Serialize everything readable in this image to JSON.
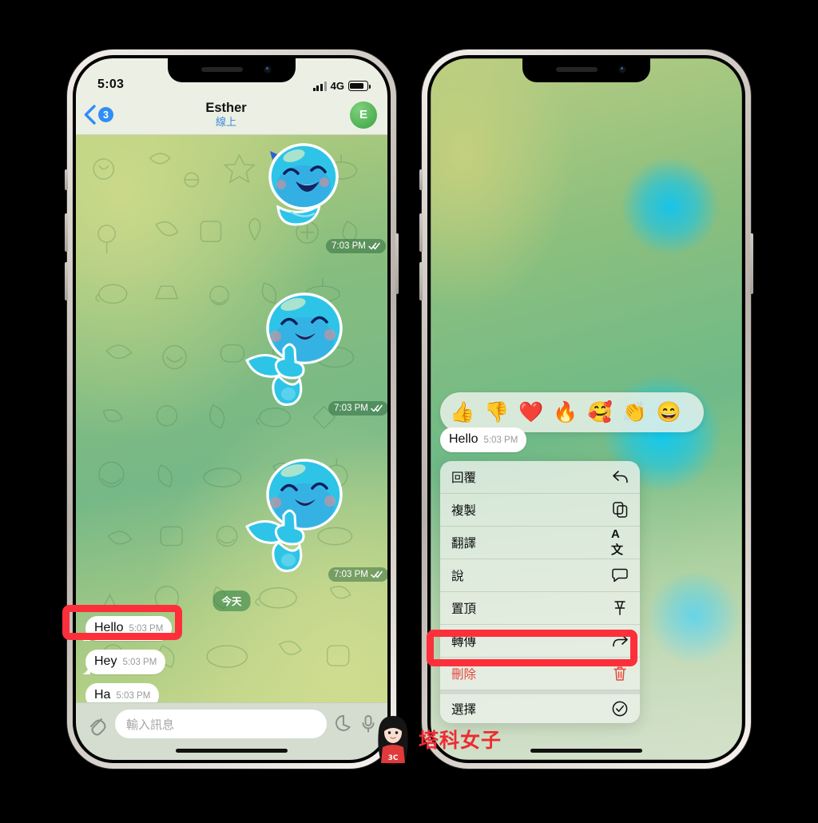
{
  "left_phone": {
    "status_bar": {
      "time": "5:03",
      "network": "4G",
      "battery_level": 72
    },
    "header": {
      "back_badge": "3",
      "contact_name": "Esther",
      "contact_status": "線上",
      "avatar_initial": "E"
    },
    "messages": [
      {
        "type": "sticker",
        "sticker": "blue-blob-laughing",
        "time": "7:03 PM",
        "status": "read"
      },
      {
        "type": "sticker",
        "sticker": "blue-blob-thumbs-up",
        "time": "7:03 PM",
        "status": "read"
      },
      {
        "type": "sticker",
        "sticker": "blue-blob-thumbs-up",
        "time": "7:03 PM",
        "status": "read"
      }
    ],
    "day_divider": "今天",
    "incoming": [
      {
        "text": "Hello",
        "time": "5:03 PM"
      },
      {
        "text": "Hey",
        "time": "5:03 PM"
      },
      {
        "text": "Ha",
        "time": "5:03 PM"
      }
    ],
    "input_bar": {
      "placeholder": "輸入訊息",
      "attach_icon": "paperclip-icon",
      "sticker_icon": "sticker-icon",
      "mic_icon": "microphone-icon"
    }
  },
  "right_phone": {
    "reactions": [
      "👍",
      "👎",
      "❤️",
      "🔥",
      "🥰",
      "👏",
      "😄"
    ],
    "selected_message": {
      "text": "Hello",
      "time": "5:03 PM"
    },
    "context_menu": [
      {
        "label": "回覆",
        "icon": "reply-icon",
        "destructive": false
      },
      {
        "label": "複製",
        "icon": "copy-icon",
        "destructive": false
      },
      {
        "label": "翻譯",
        "icon": "translate-icon",
        "destructive": false
      },
      {
        "label": "說",
        "icon": "speak-icon",
        "destructive": false
      },
      {
        "label": "置頂",
        "icon": "pin-icon",
        "destructive": false
      },
      {
        "label": "轉傳",
        "icon": "forward-icon",
        "destructive": false
      },
      {
        "label": "刪除",
        "icon": "trash-icon",
        "destructive": true
      },
      {
        "label": "選擇",
        "icon": "select-icon",
        "destructive": false
      }
    ]
  },
  "annotations": {
    "highlight_color": "#fd2f3b",
    "highlighted_left": "Hello",
    "highlighted_right": "轉傳"
  },
  "watermark": {
    "text": "塔科女子",
    "badge": "3C",
    "color": "#ee2b32"
  }
}
